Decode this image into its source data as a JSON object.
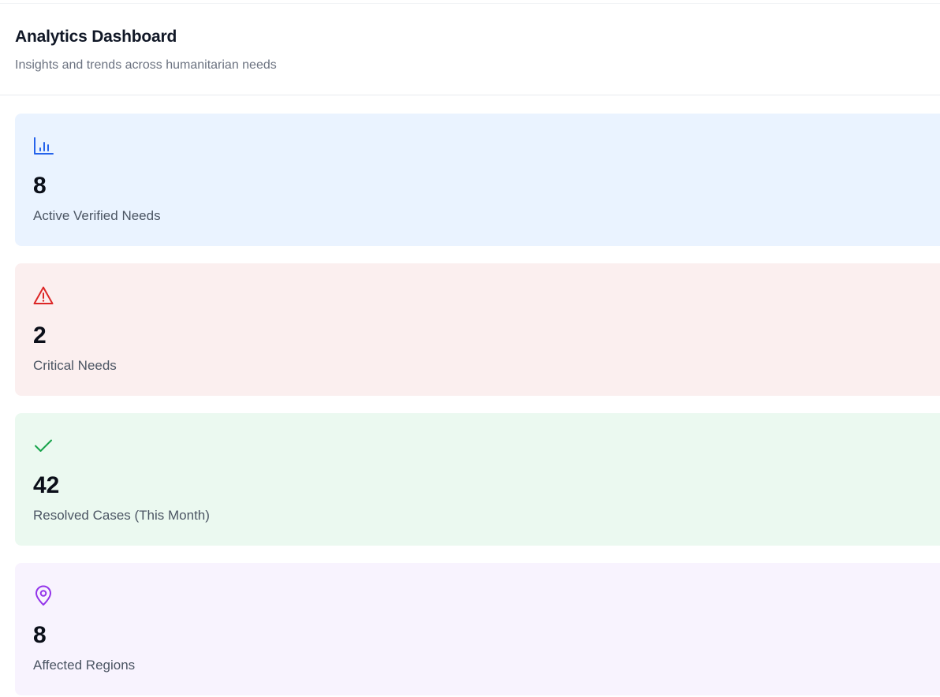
{
  "header": {
    "title": "Analytics Dashboard",
    "subtitle": "Insights and trends across humanitarian needs"
  },
  "stats": [
    {
      "icon": "bar-chart-icon",
      "value": "8",
      "label": "Active Verified Needs",
      "bg": "#eaf3ff",
      "accent": "#2563eb"
    },
    {
      "icon": "alert-triangle-icon",
      "value": "2",
      "label": "Critical Needs",
      "bg": "#fbefef",
      "accent": "#dc2626"
    },
    {
      "icon": "check-icon",
      "value": "42",
      "label": "Resolved Cases (This Month)",
      "bg": "#ebf9f0",
      "accent": "#16a34a"
    },
    {
      "icon": "map-pin-icon",
      "value": "8",
      "label": "Affected Regions",
      "bg": "#f8f3fe",
      "accent": "#9333ea"
    }
  ]
}
